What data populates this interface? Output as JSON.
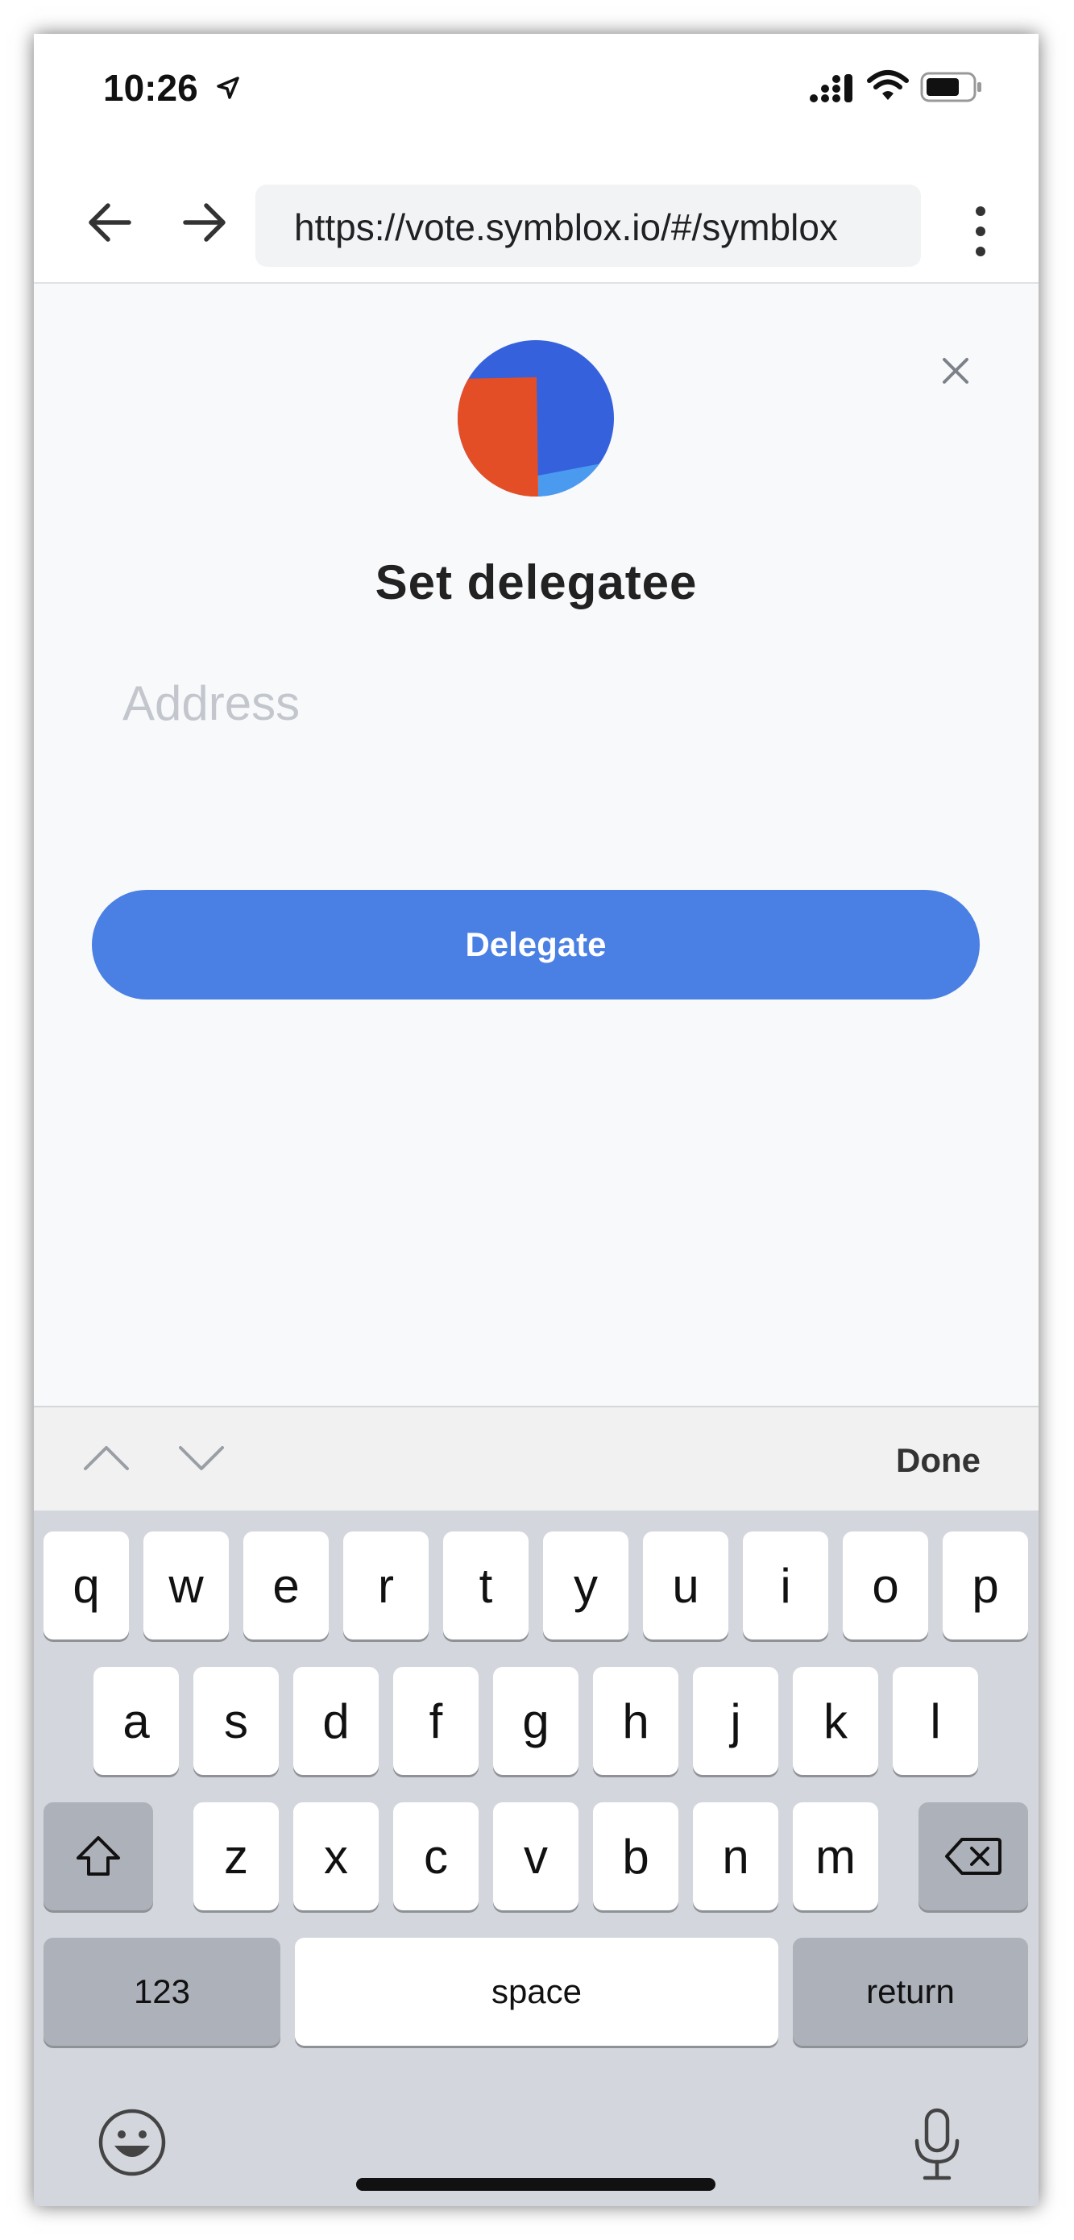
{
  "status_bar": {
    "time": "10:26"
  },
  "browser": {
    "url": "https://vote.symblox.io/#/symblox"
  },
  "dialog": {
    "title": "Set delegatee",
    "address_placeholder": "Address",
    "address_value": "",
    "delegate_label": "Delegate",
    "logo_colors": [
      "#3561dd",
      "#e44e27",
      "#4a9bf0",
      "#f08a24"
    ]
  },
  "accessory": {
    "done_label": "Done"
  },
  "keyboard": {
    "row1": [
      "q",
      "w",
      "e",
      "r",
      "t",
      "y",
      "u",
      "i",
      "o",
      "p"
    ],
    "row2": [
      "a",
      "s",
      "d",
      "f",
      "g",
      "h",
      "j",
      "k",
      "l"
    ],
    "row3": [
      "z",
      "x",
      "c",
      "v",
      "b",
      "n",
      "m"
    ],
    "numbers_label": "123",
    "space_label": "space",
    "return_label": "return"
  },
  "colors": {
    "accent": "#4a7fe3",
    "keyboard_bg": "#d3d6dc"
  }
}
